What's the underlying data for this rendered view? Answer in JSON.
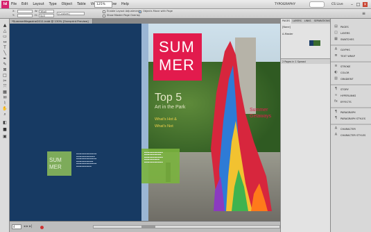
{
  "app": {
    "logo": "Id"
  },
  "menu": [
    "File",
    "Edit",
    "Layout",
    "Type",
    "Object",
    "Table",
    "View",
    "Window",
    "Help"
  ],
  "zoom": "125%",
  "workspace": "TYPOGRAPHY",
  "cslive": "CS Live",
  "control": {
    "x_label": "X:",
    "y_label": "Y:",
    "w_label": "W:",
    "h_label": "H:",
    "w_value": "36p0",
    "h_value": "0p0",
    "font_value": "[Custom]",
    "enable_layout": "Enable Layout Adjustment",
    "show_master": "Show Master Page Overlay",
    "objects_move": "Objects Move with Page"
  },
  "doc_tab": "*SummerMagazine2011.indd @ 130% [Overprint Preview]",
  "doc": {
    "summer1": "SUM",
    "summer2": "MER",
    "top5": "Top 5",
    "art": "Art in the Park",
    "hot": "What's Hot &",
    "not": "What's Not",
    "getaways1": "Summer",
    "getaways2": "Getaways",
    "left_summer1": "SUM",
    "left_summer2": "MER"
  },
  "panel": {
    "tabs": [
      "PAGES",
      "LAYERS",
      "LINKS",
      "SEPARATIONS"
    ],
    "none": "[None]",
    "master": "A-Master",
    "footer": "2 Pages in 1 Spread"
  },
  "dock": [
    "PAGES",
    "LAYERS",
    "SWATCHES",
    "GLYPHS",
    "TEXT WRAP",
    "STROKE",
    "COLOR",
    "GRADIENT",
    "STORY",
    "HYPERLINKS",
    "EFFECTS",
    "PARAGRAPH",
    "PARAGRAPH STYLES",
    "CHARACTER",
    "CHARACTER STYLES"
  ],
  "status": {
    "page": "4"
  }
}
